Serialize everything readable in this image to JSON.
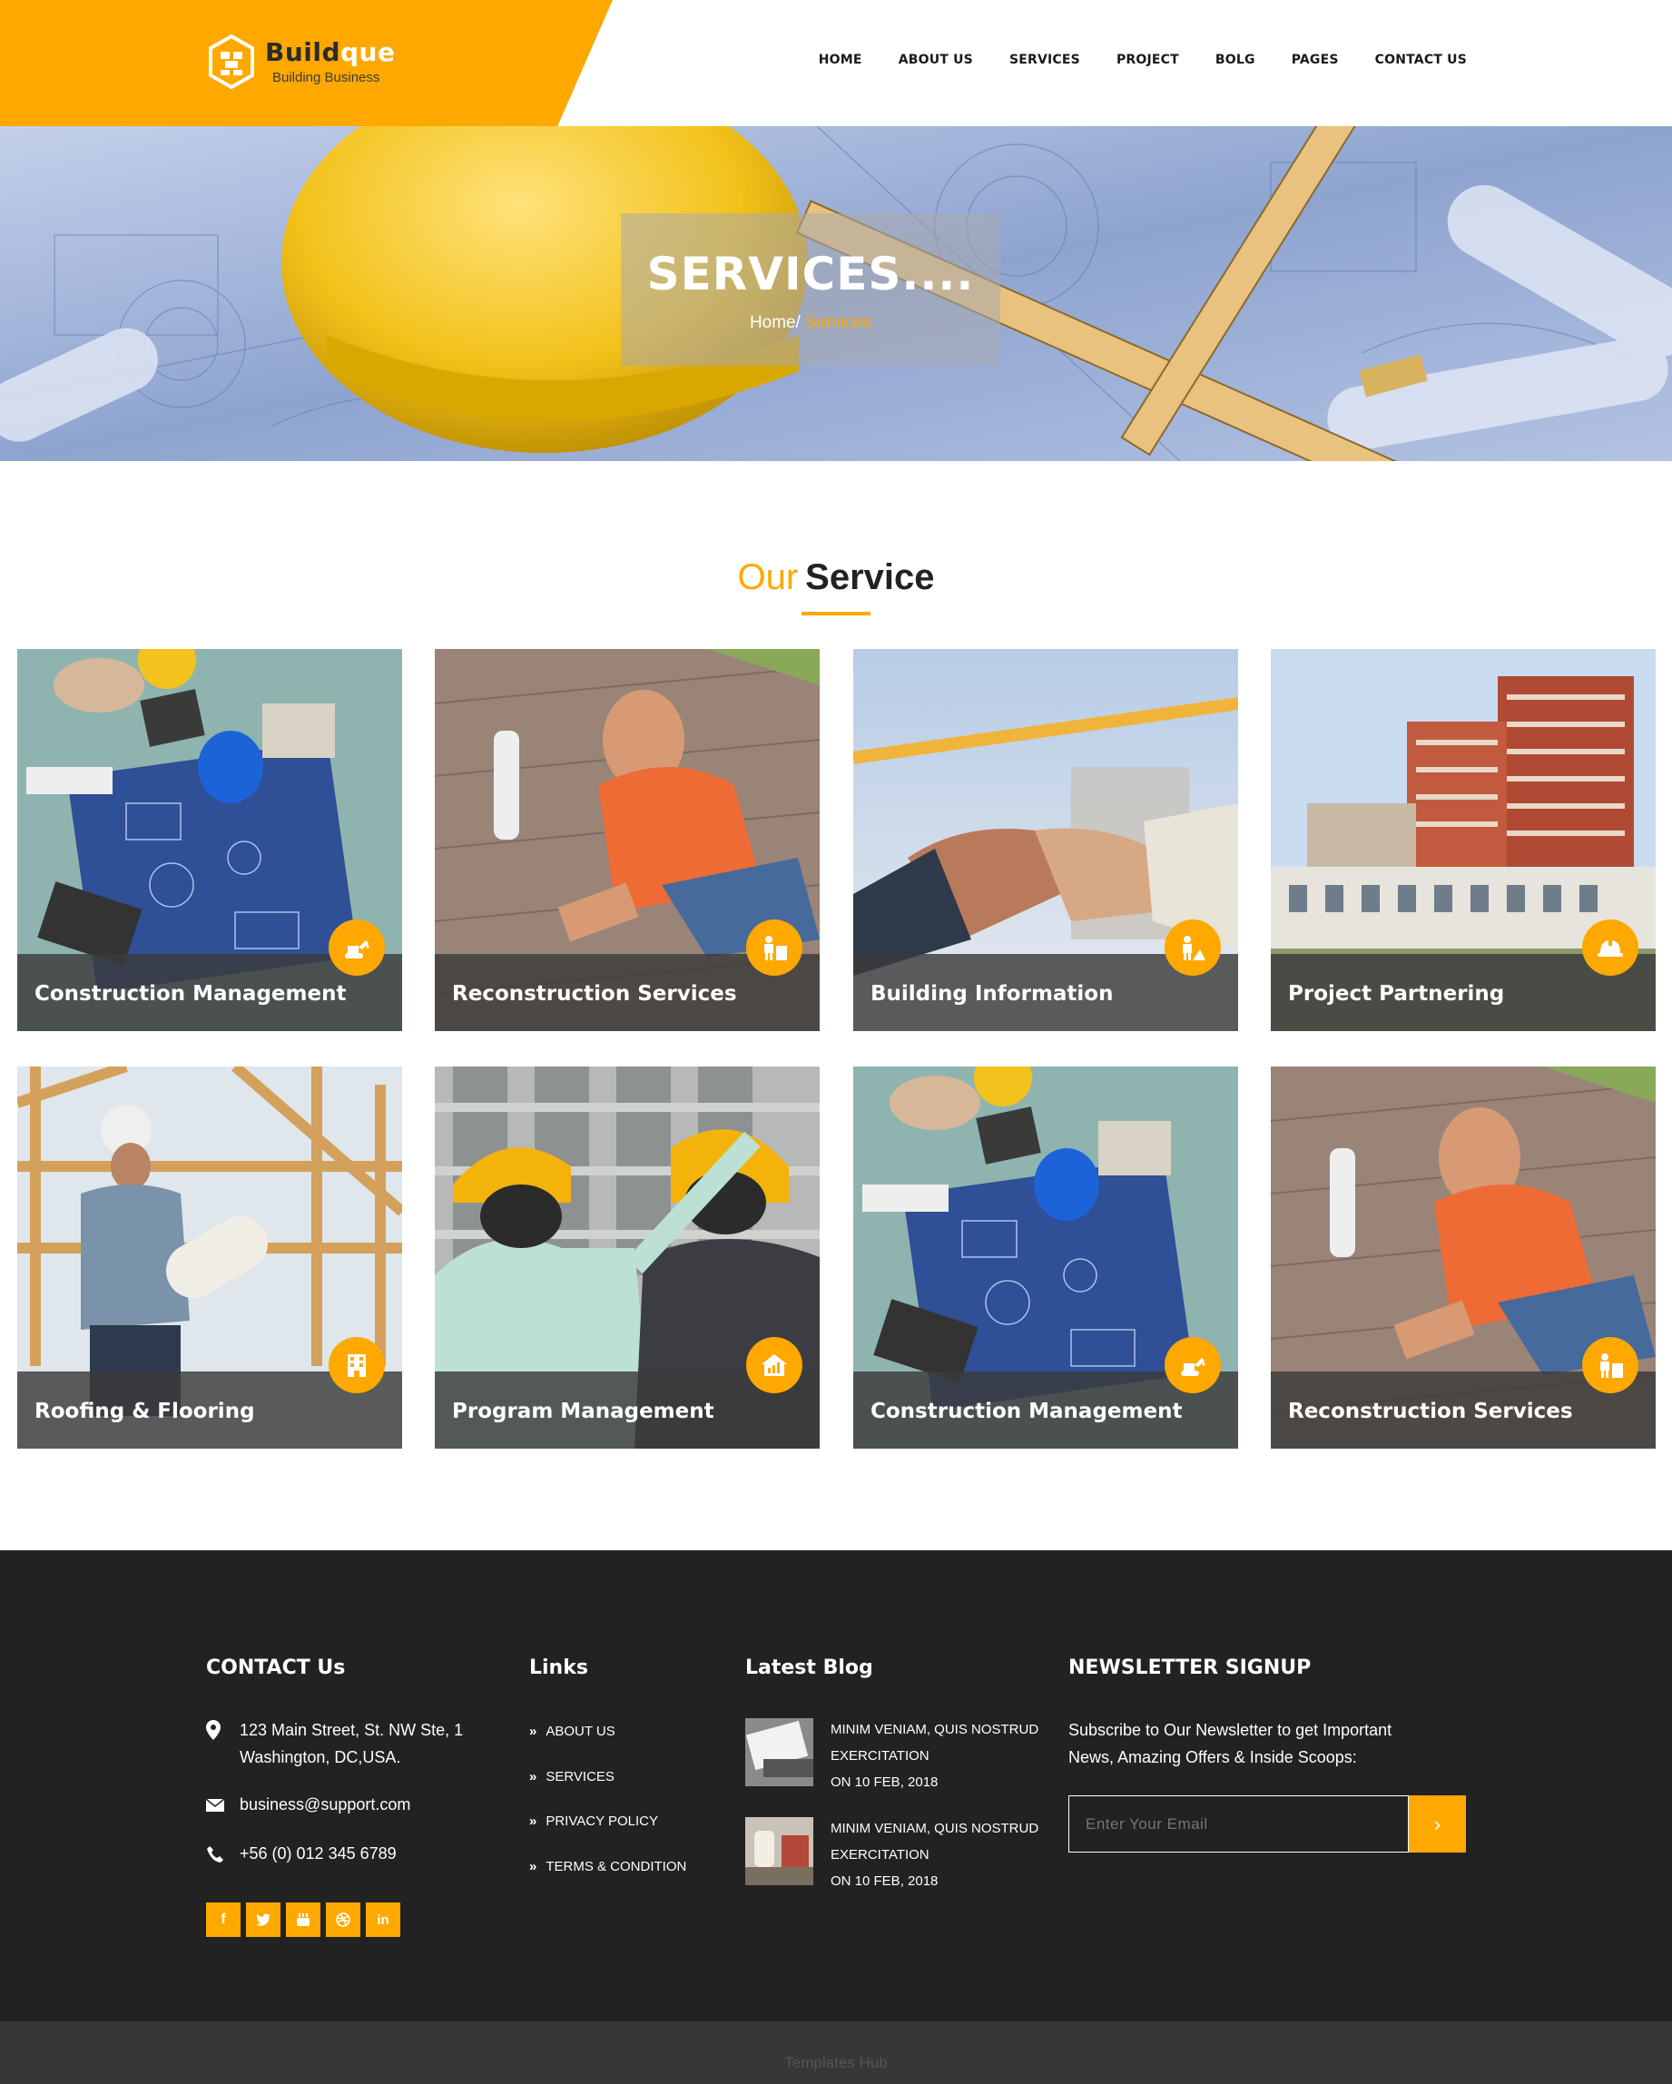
{
  "brand": {
    "name_part1": "Build",
    "name_part2": "que",
    "tagline": "Building Business",
    "accent_color": "#ffa800"
  },
  "nav": {
    "items": [
      "HOME",
      "ABOUT US",
      "SERVICES",
      "PROJECT",
      "BOLG",
      "PAGES",
      "CONTACT US"
    ]
  },
  "hero": {
    "title": "SERVICES....",
    "breadcrumb_home": "Home/",
    "breadcrumb_current": "Services"
  },
  "section": {
    "title_light": "Our",
    "title_bold": "Service"
  },
  "services": [
    {
      "label": "Construction Management",
      "icon": "excavator-icon"
    },
    {
      "label": "Reconstruction Services",
      "icon": "worker-icon"
    },
    {
      "label": "Building Information",
      "icon": "worker-shovel-icon"
    },
    {
      "label": "Project Partnering",
      "icon": "hard-hat-icon"
    },
    {
      "label": "Roofing & Flooring",
      "icon": "building-icon"
    },
    {
      "label": "Program Management",
      "icon": "house-growth-icon"
    },
    {
      "label": "Construction Management",
      "icon": "excavator-icon"
    },
    {
      "label": "Reconstruction Services",
      "icon": "worker-icon"
    }
  ],
  "footer": {
    "contact": {
      "heading": "CONTACT Us",
      "address_line1": "123 Main Street, St. NW Ste, 1",
      "address_line2": "Washington, DC,USA.",
      "email": "business@support.com",
      "phone": "+56 (0) 012 345 6789",
      "social": [
        "f",
        "t",
        "yt",
        "dr",
        "in"
      ]
    },
    "links": {
      "heading": "Links",
      "items": [
        "ABOUT US",
        "SERVICES",
        "PRIVACY POLICY",
        "TERMS & CONDITION"
      ]
    },
    "blog": {
      "heading": "Latest Blog",
      "posts": [
        {
          "line1": "MINIM VENIAM, QUIS NOSTRUD",
          "line2": "EXERCITATION",
          "date": "ON 10 FEB, 2018"
        },
        {
          "line1": "MINIM VENIAM, QUIS NOSTRUD",
          "line2": "EXERCITATION",
          "date": "ON 10 FEB, 2018"
        }
      ]
    },
    "newsletter": {
      "heading": "NEWSLETTER SIGNUP",
      "text_line1": "Subscribe to Our Newsletter to get Important",
      "text_line2": "News, Amazing Offers & Inside Scoops:",
      "placeholder": "Enter Your Email",
      "button": "›"
    },
    "copyright": "Templates Hub"
  }
}
